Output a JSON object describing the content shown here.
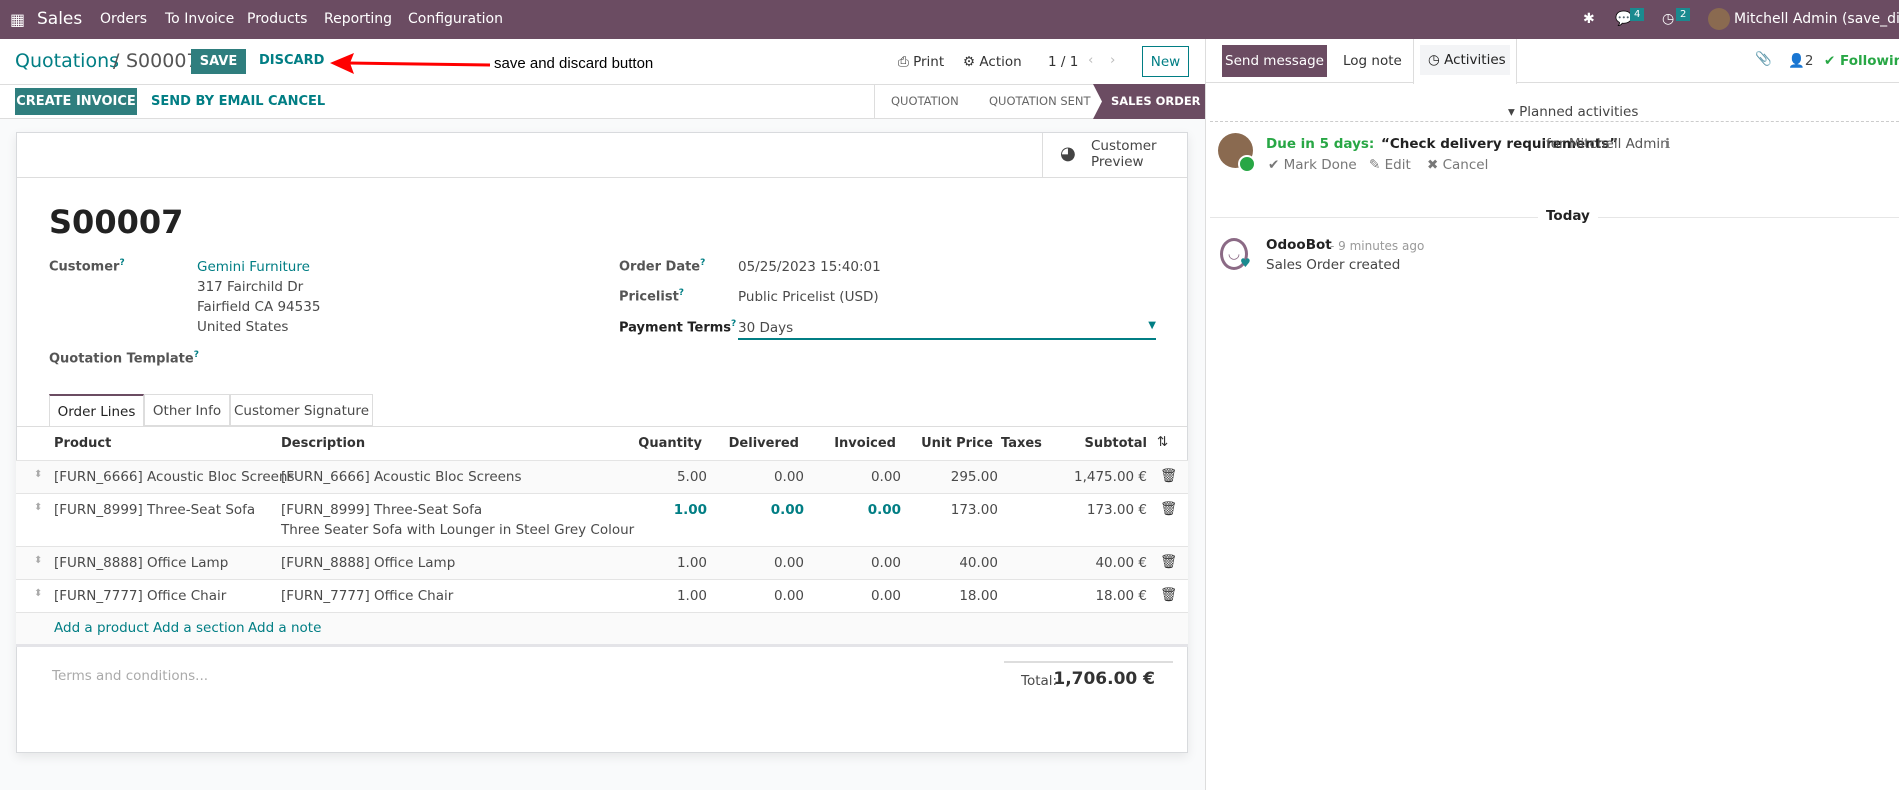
{
  "navbar": {
    "app": "Sales",
    "menu": [
      "Orders",
      "To Invoice",
      "Products",
      "Reporting",
      "Configuration"
    ],
    "messages_count": "4",
    "activities_count": "2",
    "user": "Mitchell Admin (save_discard"
  },
  "header": {
    "breadcrumb_parent": "Quotations",
    "breadcrumb_sep": "/",
    "record": "S00007",
    "save": "SAVE",
    "discard": "DISCARD",
    "annotation": "save and discard button",
    "print": "Print",
    "action": "Action",
    "pager": "1 / 1",
    "new": "New"
  },
  "actions": {
    "create_invoice": "CREATE INVOICE",
    "send_email": "SEND BY EMAIL",
    "cancel": "CANCEL",
    "status": [
      "QUOTATION",
      "QUOTATION SENT",
      "SALES ORDER"
    ]
  },
  "form": {
    "customer_preview": "Customer Preview",
    "name": "S00007",
    "customer_label": "Customer",
    "customer": "Gemini Furniture",
    "address": [
      "317 Fairchild Dr",
      "Fairfield CA 94535",
      "United States"
    ],
    "template_label": "Quotation Template",
    "order_date_label": "Order Date",
    "order_date": "05/25/2023 15:40:01",
    "pricelist_label": "Pricelist",
    "pricelist": "Public Pricelist (USD)",
    "payment_terms_label": "Payment Terms",
    "payment_terms": "30 Days",
    "help": "?",
    "tabs": [
      "Order Lines",
      "Other Info",
      "Customer Signature"
    ],
    "columns": [
      "Product",
      "Description",
      "Quantity",
      "Delivered",
      "Invoiced",
      "Unit Price",
      "Taxes",
      "Subtotal"
    ],
    "lines": [
      {
        "product": "[FURN_6666] Acoustic Bloc Screens",
        "description": "[FURN_6666] Acoustic Bloc Screens",
        "description2": "",
        "qty": "5.00",
        "delivered": "0.00",
        "invoiced": "0.00",
        "price": "295.00",
        "subtotal": "1,475.00 €"
      },
      {
        "product": "[FURN_8999] Three-Seat Sofa",
        "description": "[FURN_8999] Three-Seat Sofa",
        "description2": "Three Seater Sofa with Lounger in Steel Grey Colour",
        "qty": "1.00",
        "delivered": "0.00",
        "invoiced": "0.00",
        "price": "173.00",
        "subtotal": "173.00 €"
      },
      {
        "product": "[FURN_8888] Office Lamp",
        "description": "[FURN_8888] Office Lamp",
        "description2": "",
        "qty": "1.00",
        "delivered": "0.00",
        "invoiced": "0.00",
        "price": "40.00",
        "subtotal": "40.00 €"
      },
      {
        "product": "[FURN_7777] Office Chair",
        "description": "[FURN_7777] Office Chair",
        "description2": "",
        "qty": "1.00",
        "delivered": "0.00",
        "invoiced": "0.00",
        "price": "18.00",
        "subtotal": "18.00 €"
      }
    ],
    "add_product": "Add a product",
    "add_section": "Add a section",
    "add_note": "Add a note",
    "terms_placeholder": "Terms and conditions...",
    "total_label": "Total:",
    "total": "1,706.00 €"
  },
  "chatter": {
    "send_message": "Send message",
    "log_note": "Log note",
    "activities": "Activities",
    "followers": "2",
    "following": "Following",
    "planned": "Planned activities",
    "due": "Due in 5 days:",
    "activity": "“Check delivery requirements”",
    "for": "for Mitchell Admin",
    "mark_done": "Mark Done",
    "edit": "Edit",
    "cancel": "Cancel",
    "today": "Today",
    "author": "OdooBot",
    "time": "- 9 minutes ago",
    "message": "Sales Order created"
  },
  "colors": {
    "brand": "#6b4c62",
    "primary": "#2f7e7e",
    "link": "#017e84",
    "due": "#28a745"
  }
}
